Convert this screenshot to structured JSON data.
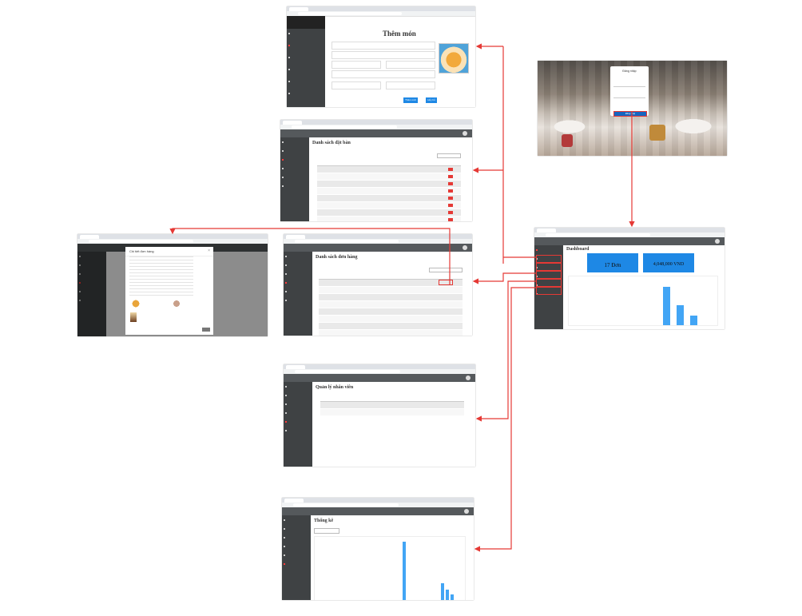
{
  "colors": {
    "accent": "#e53935",
    "primary": "#1e88e5",
    "sidebar": "#3f4244",
    "topbar": "#55595c",
    "chart": "#42a5f5"
  },
  "add_dish": {
    "title": "Thêm món",
    "submit_label": "Thêm mới",
    "back_label": "Hủy bỏ"
  },
  "login": {
    "title": "Đăng nhập",
    "button": "Đăng nhập"
  },
  "reservations": {
    "title": "Danh sách đặt bàn"
  },
  "order_detail": {
    "title": "Chi tiết đơn hàng"
  },
  "orders": {
    "title": "Danh sách đơn hàng"
  },
  "dashboard": {
    "title": "Dashboard",
    "orders_value": "17 Đơn",
    "revenue_value": "4,048,000 VND"
  },
  "staff": {
    "title": "Quản lý nhân viên"
  },
  "stats": {
    "title": "Thống kê"
  }
}
